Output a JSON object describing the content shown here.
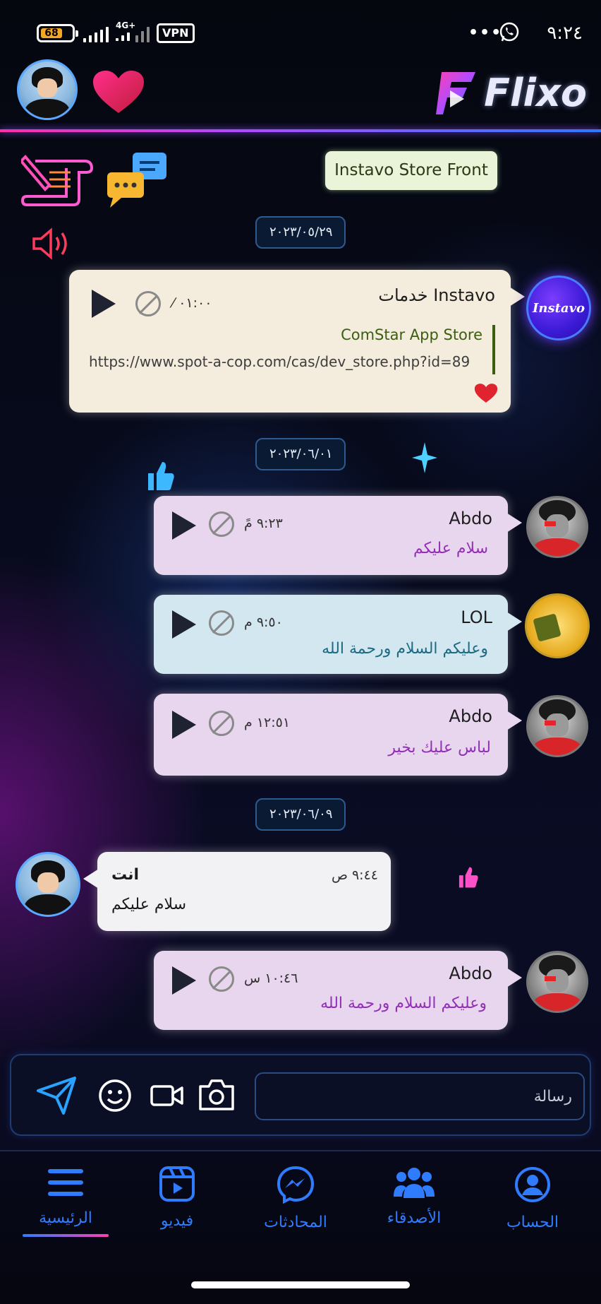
{
  "status_bar": {
    "battery": "68",
    "network": "4G+",
    "vpn": "VPN",
    "more": "•••",
    "time": "٩:٢٤"
  },
  "header": {
    "brand": "Flixo"
  },
  "store_pill": "Instavo Store Front",
  "messages": [
    {
      "type": "date",
      "label": "٢٠٢٣/٠٥/٢٩"
    },
    {
      "type": "link-card",
      "sender": "خدمات Instavo",
      "time": "٠١:٠٠ ⁄",
      "link_title": "ComStar App Store",
      "url": "https://www.spot-a-cop.com/cas/dev_store.php?id=89",
      "avatar_text": "Instavo",
      "liked": true
    },
    {
      "type": "date",
      "label": "٢٠٢٣/٠٦/٠١"
    },
    {
      "type": "voice",
      "sender": "Abdo",
      "time": "٩:٢٣ مً",
      "text": "سلام عليكم"
    },
    {
      "type": "voice",
      "sender": "LOL",
      "time": "٩:٥٠ م",
      "text": "وعليكم السلام ورحمة الله"
    },
    {
      "type": "voice",
      "sender": "Abdo",
      "time": "١٢:٥١ م",
      "text": "لباس عليك بخير"
    },
    {
      "type": "date",
      "label": "٢٠٢٣/٠٦/٠٩"
    },
    {
      "type": "outgoing",
      "sender": "انت",
      "time": "٩:٤٤ ص",
      "text": "سلام عليكم"
    },
    {
      "type": "voice",
      "sender": "Abdo",
      "time": "١٠:٤٦ س",
      "text": "وعليكم السلام ورحمة الله"
    }
  ],
  "composer": {
    "placeholder": "رسالة"
  },
  "nav": {
    "items": [
      {
        "label": "الرئيسية",
        "icon": "menu-icon",
        "active": true
      },
      {
        "label": "فيديو",
        "icon": "video-icon",
        "active": false
      },
      {
        "label": "المحادثات",
        "icon": "messenger-icon",
        "active": false
      },
      {
        "label": "الأصدقاء",
        "icon": "friends-icon",
        "active": false
      },
      {
        "label": "الحساب",
        "icon": "account-icon",
        "active": false
      }
    ]
  },
  "colors": {
    "accent": "#2f7cff",
    "bubble_pink": "#e8d5ee",
    "bubble_blue": "#d3e7f1",
    "bubble_cream": "#f4ecdc",
    "link_green": "#3b5e12"
  }
}
